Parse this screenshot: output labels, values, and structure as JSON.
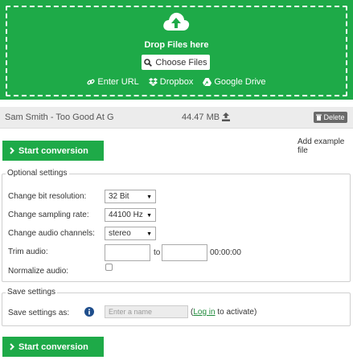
{
  "upload": {
    "drop_text": "Drop Files here",
    "choose_label": "Choose Files",
    "sources": [
      {
        "label": "Enter URL",
        "icon": "link-icon"
      },
      {
        "label": "Dropbox",
        "icon": "dropbox-icon"
      },
      {
        "label": "Google Drive",
        "icon": "google-drive-icon"
      }
    ],
    "accent_color": "#1eaa48"
  },
  "file": {
    "name": "Sam Smith - Too Good At G",
    "size": "44.47 MB",
    "delete_label": "Delete"
  },
  "actions": {
    "start_label": "Start conversion",
    "add_example": "Add example file"
  },
  "optional_settings": {
    "legend": "Optional settings",
    "bit_resolution": {
      "label": "Change bit resolution:",
      "value": "32 Bit"
    },
    "sampling_rate": {
      "label": "Change sampling rate:",
      "value": "44100 Hz"
    },
    "audio_channels": {
      "label": "Change audio channels:",
      "value": "stereo"
    },
    "trim": {
      "label": "Trim audio:",
      "to": "to",
      "time": "00:00:00"
    },
    "normalize": {
      "label": "Normalize audio:",
      "checked": false
    }
  },
  "save_settings": {
    "legend": "Save settings",
    "label": "Save settings as:",
    "placeholder": "Enter a name",
    "login_prefix": "(",
    "login_link": "Log in",
    "login_suffix": " to activate)"
  }
}
